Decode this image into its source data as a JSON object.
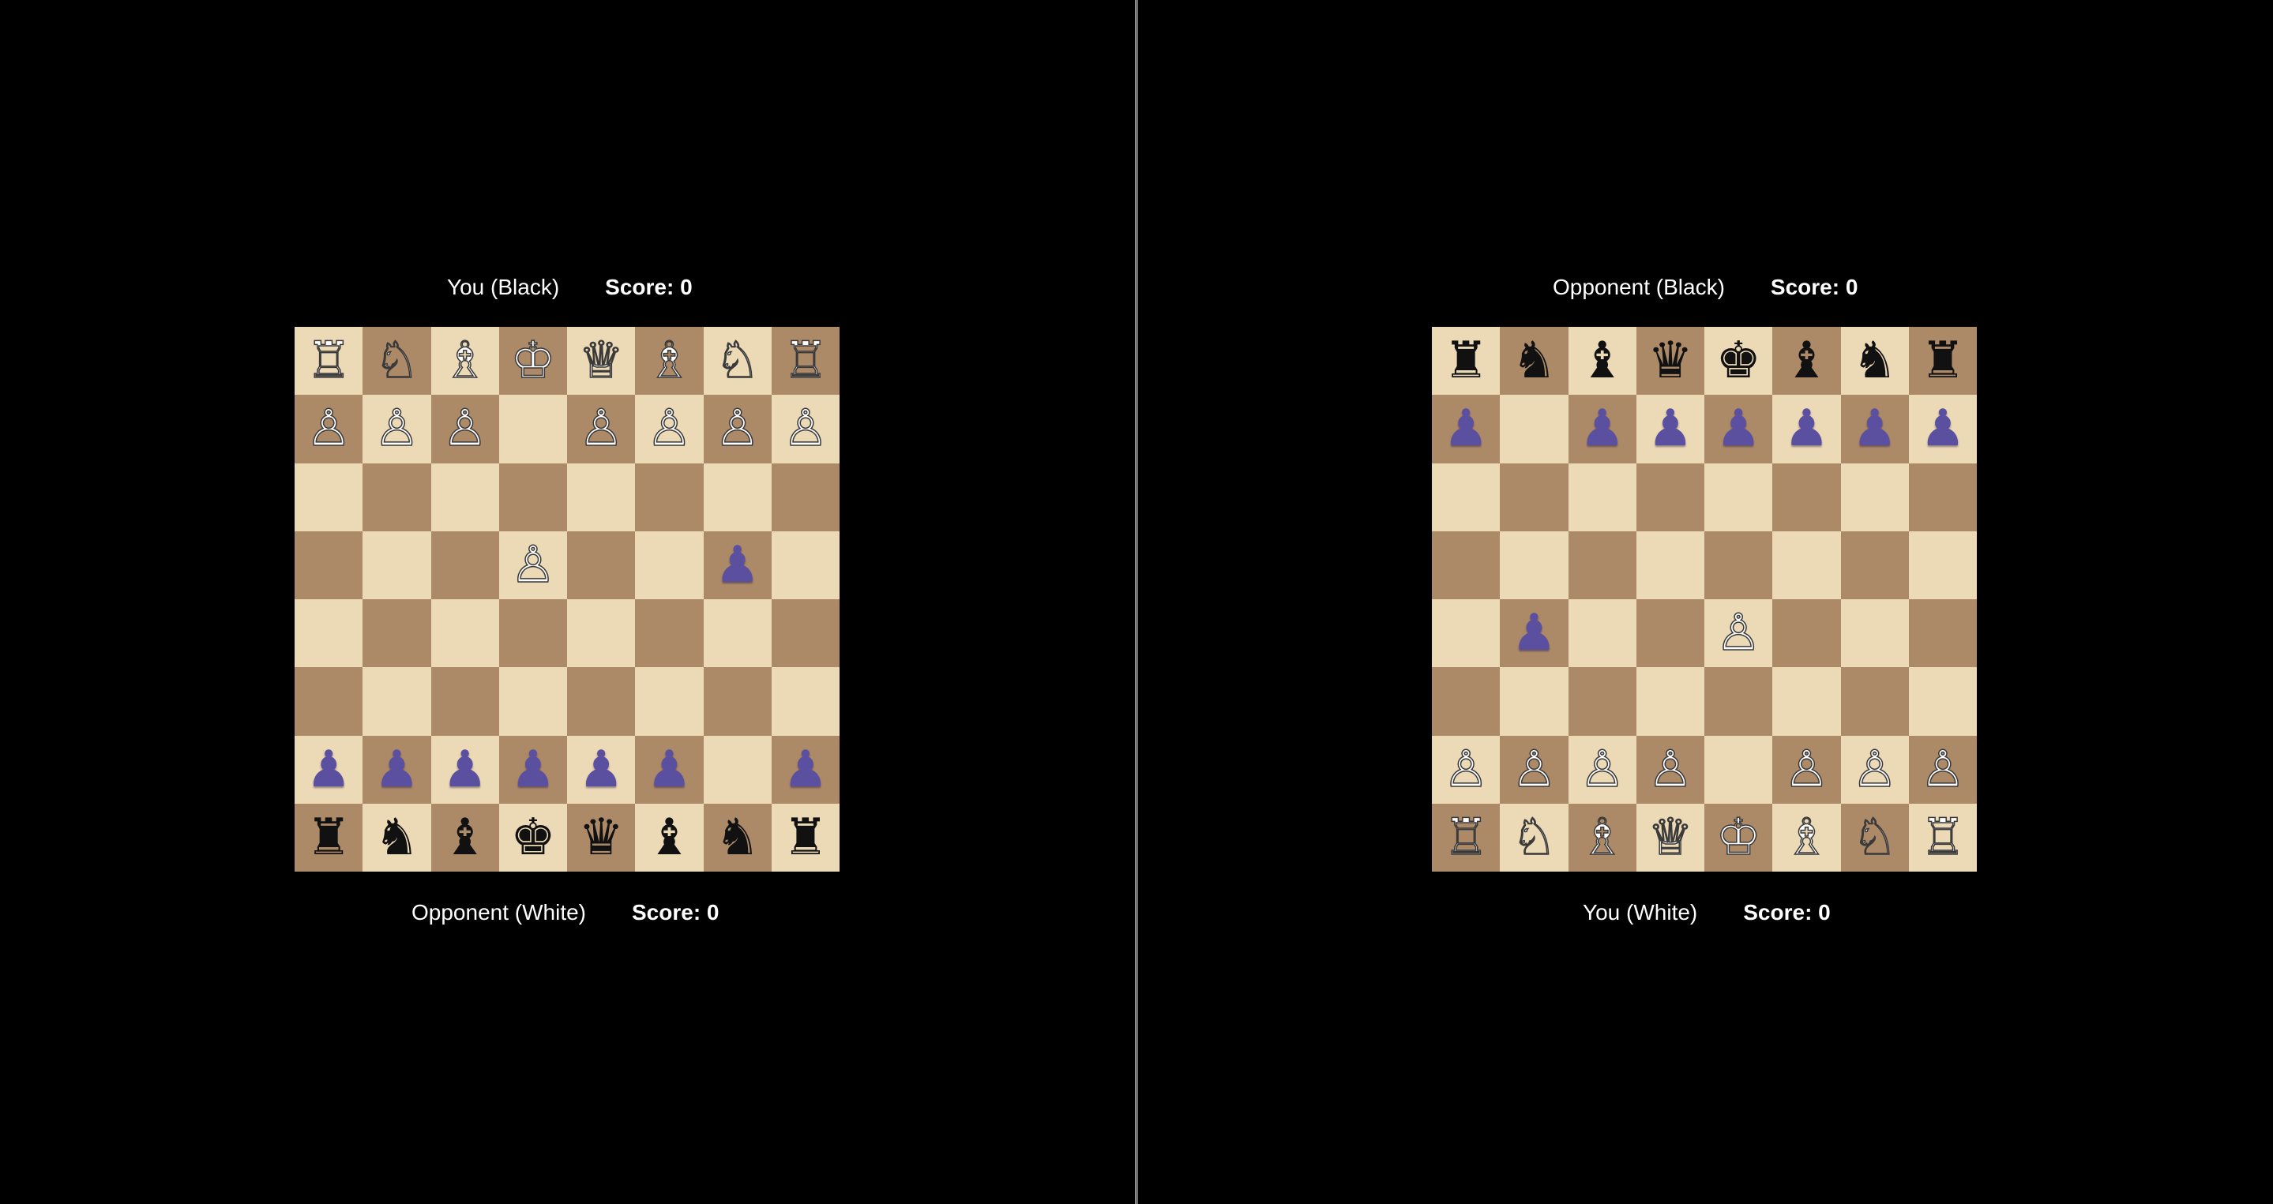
{
  "colors": {
    "background": "#000000",
    "light_square": "#ecd9b5",
    "dark_square": "#ad8a67",
    "divider": "#6f6f6f",
    "text": "#ffffff",
    "my_pawn_purple": "#5b4fa0"
  },
  "left_pane": {
    "top_player": {
      "name": "You (Black)",
      "score": "Score: 0"
    },
    "bottom_player": {
      "name": "Opponent (White)",
      "score": "Score: 0"
    },
    "board": [
      [
        "wR",
        "wN",
        "wB",
        "wK",
        "wQ",
        "wB",
        "wN",
        "wR"
      ],
      [
        "wP",
        "wP",
        "wP",
        "",
        "wP",
        "wP",
        "wP",
        "wP"
      ],
      [
        "",
        "",
        "",
        "",
        "",
        "",
        "",
        ""
      ],
      [
        "",
        "",
        "",
        "wP",
        "",
        "",
        "pP",
        ""
      ],
      [
        "",
        "",
        "",
        "",
        "",
        "",
        "",
        ""
      ],
      [
        "",
        "",
        "",
        "",
        "",
        "",
        "",
        ""
      ],
      [
        "pP",
        "pP",
        "pP",
        "pP",
        "pP",
        "pP",
        "",
        "pP"
      ],
      [
        "bR",
        "bN",
        "bB",
        "bK",
        "bQ",
        "bB",
        "bN",
        "bR"
      ]
    ],
    "first_square_light": true
  },
  "right_pane": {
    "top_player": {
      "name": "Opponent (Black)",
      "score": "Score: 0"
    },
    "bottom_player": {
      "name": "You (White)",
      "score": "Score: 0"
    },
    "board": [
      [
        "bR",
        "bN",
        "bB",
        "bQ",
        "bK",
        "bB",
        "bN",
        "bR"
      ],
      [
        "pP",
        "",
        "pP",
        "pP",
        "pP",
        "pP",
        "pP",
        "pP"
      ],
      [
        "",
        "",
        "",
        "",
        "",
        "",
        "",
        ""
      ],
      [
        "",
        "",
        "",
        "",
        "",
        "",
        "",
        ""
      ],
      [
        "",
        "pP",
        "",
        "",
        "wP",
        "",
        "",
        ""
      ],
      [
        "",
        "",
        "",
        "",
        "",
        "",
        "",
        ""
      ],
      [
        "wP",
        "wP",
        "wP",
        "wP",
        "",
        "wP",
        "wP",
        "wP"
      ],
      [
        "wR",
        "wN",
        "wB",
        "wQ",
        "wK",
        "wB",
        "wN",
        "wR"
      ]
    ],
    "first_square_light": true
  },
  "piece_icons": {
    "K": "king-icon",
    "Q": "queen-icon",
    "R": "rook-icon",
    "B": "bishop-icon",
    "N": "knight-icon",
    "P": "pawn-icon"
  }
}
